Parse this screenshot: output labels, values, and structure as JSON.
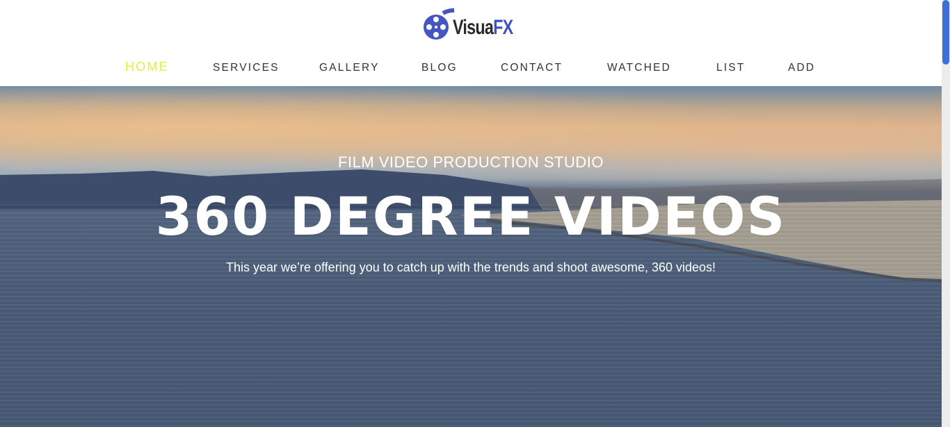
{
  "logo": {
    "part1": "Visua",
    "part2": "FX",
    "icon": "film-reel-icon"
  },
  "nav": {
    "items": [
      {
        "label": "HOME",
        "active": true
      },
      {
        "label": "SERVICES",
        "active": false
      },
      {
        "label": "GALLERY",
        "active": false
      },
      {
        "label": "BLOG",
        "active": false
      },
      {
        "label": "CONTACT",
        "active": false
      },
      {
        "label": "WATCHED",
        "active": false
      },
      {
        "label": "LIST",
        "active": false
      },
      {
        "label": "ADD",
        "active": false
      }
    ]
  },
  "hero": {
    "subtitle": "FILM VIDEO PRODUCTION STUDIO",
    "title": "360 DEGREE VIDEOS",
    "text": "This year we’re offering you to catch up with the trends and shoot awesome, 360 videos!"
  },
  "colors": {
    "active_nav": "#e2ee3a",
    "brand_blue": "#3f52c4",
    "scroll_thumb": "#3f6fd6"
  }
}
